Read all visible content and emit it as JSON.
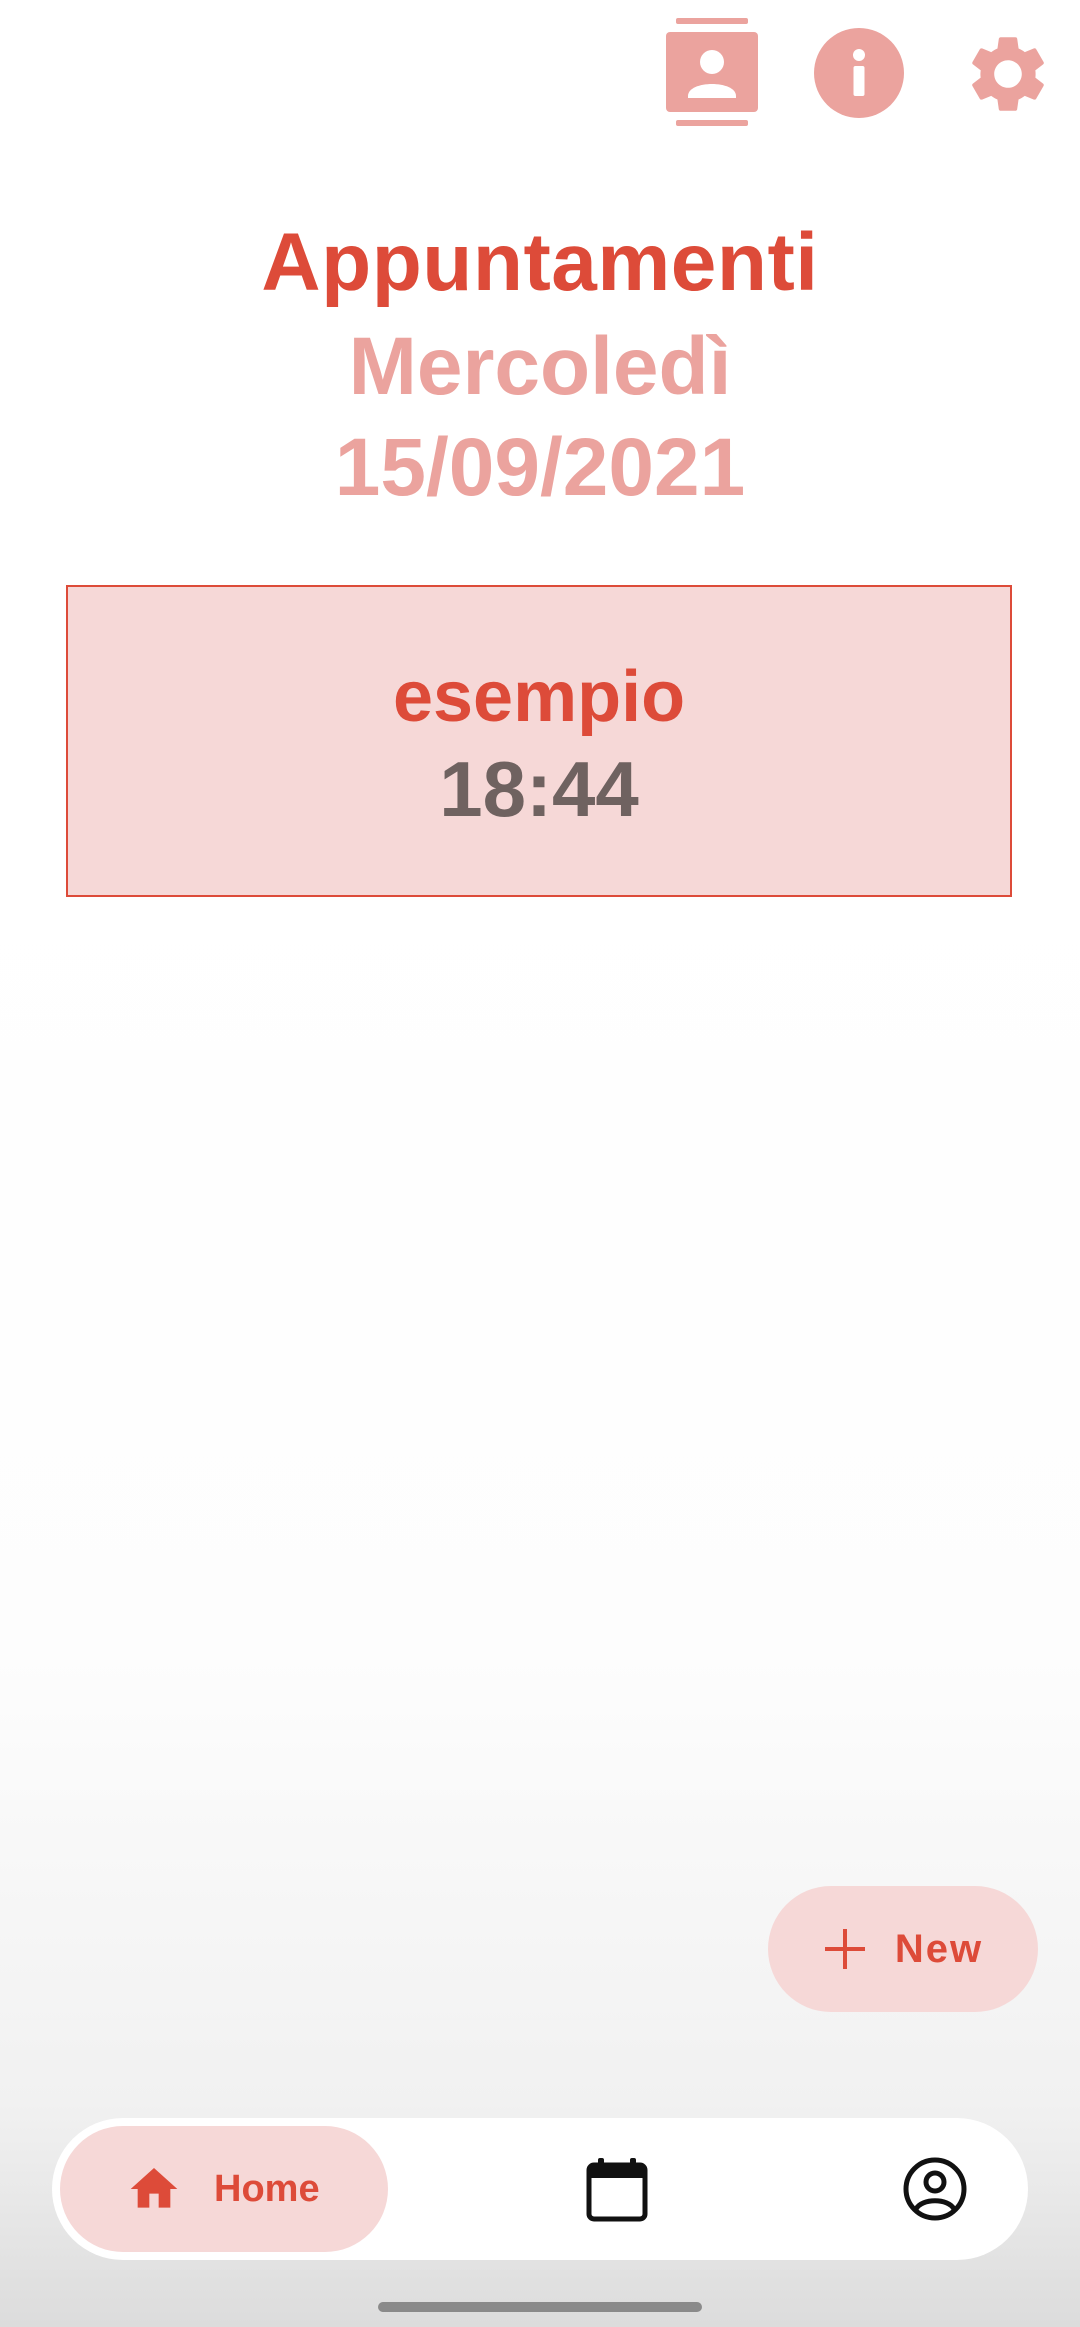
{
  "header": {
    "title": "Appuntamenti",
    "weekday": "Mercoledì",
    "date": "15/09/2021"
  },
  "appointments": [
    {
      "name": "esempio",
      "time": "18:44"
    }
  ],
  "fab": {
    "label": "New",
    "icon": "plus-icon"
  },
  "top_actions": [
    {
      "icon": "contacts-icon"
    },
    {
      "icon": "info-icon"
    },
    {
      "icon": "settings-icon"
    }
  ],
  "bottom_nav": {
    "items": [
      {
        "label": "Home",
        "icon": "home-icon",
        "active": true
      },
      {
        "label": "",
        "icon": "calendar-icon",
        "active": false
      },
      {
        "label": "",
        "icon": "account-icon",
        "active": false
      }
    ]
  },
  "colors": {
    "primary": "#dd4b39",
    "primary_light": "#eba39e",
    "container": "#f6d8d7",
    "time_text": "#6f6260"
  }
}
